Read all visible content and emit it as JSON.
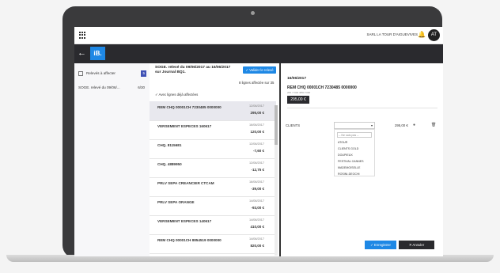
{
  "topbar": {
    "user_name": "SARL LA TOUR D'AIGUEVIVES",
    "avatar_initials": "AT"
  },
  "brand": {
    "logo_text": "iB."
  },
  "sidebar": {
    "items": [
      {
        "label": "Relevés à affecter",
        "count": "5"
      },
      {
        "label": "SOGE. relevé du 09/06/...",
        "count": "6/30"
      }
    ]
  },
  "middle": {
    "title": "SOGE. relevé du 09/06/2017 au 16/06/2017 sur Journal BQ1.",
    "validate_label": "✓ Valider le relevé",
    "lines_affected": "8 lignes affectée sur 35",
    "show_affected_label": "✓ Avec lignes déjà affectées",
    "transactions": [
      {
        "label": "REM CHQ 00001CH 7230485 0000000",
        "date": "12/06/2017",
        "amount": "295,00 €"
      },
      {
        "label": "VERSEMENT ESPECES 160617",
        "date": "16/06/2017",
        "amount": "120,00 €"
      },
      {
        "label": "CHQ. 8115681",
        "date": "12/06/2017",
        "amount": "-7,60 €"
      },
      {
        "label": "CHQ. 4889950",
        "date": "12/06/2017",
        "amount": "-12,75 €"
      },
      {
        "label": "PRLV SEPA CREANCIER CTCAM",
        "date": "16/06/2017",
        "amount": "-39,00 €"
      },
      {
        "label": "PRLV SEPA ORANGE",
        "date": "14/06/2017",
        "amount": "-93,00 €"
      },
      {
        "label": "VERSEMENT ESPECES 140617",
        "date": "14/06/2017",
        "amount": "410,00 €"
      },
      {
        "label": "REM CHQ 00001CH 8854519 0000000",
        "date": "14/06/2017",
        "amount": "820,00 €"
      }
    ]
  },
  "detail": {
    "date": "16/06/2017",
    "title": "REM CHQ 00001CH 7230485 0000000",
    "subtitle": "205 / 7330 4850 7000",
    "amount": "295,00 €",
    "clients_label": "CLIENTS",
    "clients_amount": "295,00 €",
    "search_placeholder": "-- Ne sais pas --",
    "options": [
      "ATOUR",
      "CLIENTS GOLD",
      "DOUPIEUX",
      "FESTIVAL CANNES",
      "MADEMOISELLE",
      "ROSINI-DEOCHI"
    ],
    "save_label": "✓ Enregistrer",
    "cancel_label": "✕ Annuler"
  },
  "colors": {
    "accent": "#1e88e5",
    "dark": "#2a2a2e",
    "frame": "#3a3a3c"
  },
  "icons": [
    "apps-grid-icon",
    "bell-icon",
    "back-arrow-icon",
    "chat-icon",
    "trash-icon",
    "caret-down-icon"
  ]
}
